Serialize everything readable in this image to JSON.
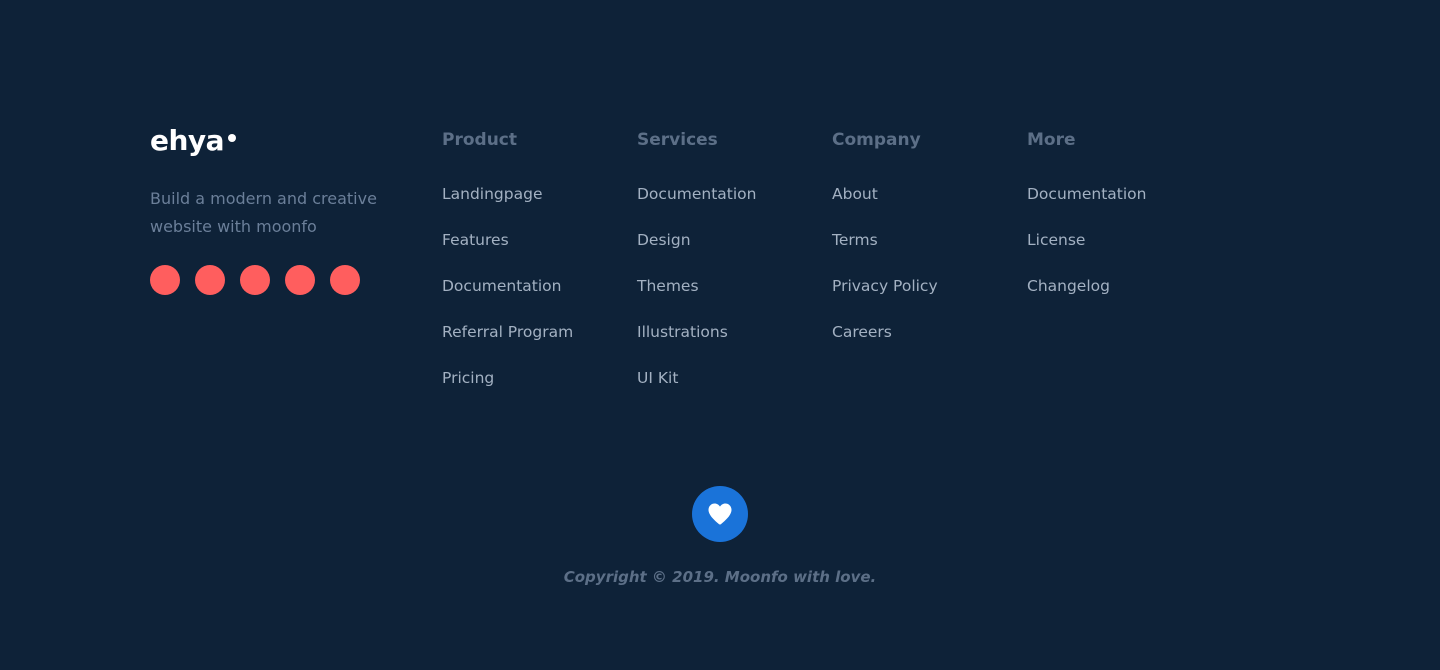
{
  "brand": {
    "logo_text": "ehya",
    "tagline": "Build a modern and creative website with moonfo",
    "social_links": [
      {
        "icon": "social-icon",
        "color": "#ff5e5e"
      },
      {
        "icon": "social-icon",
        "color": "#ff5e5e"
      },
      {
        "icon": "social-icon",
        "color": "#ff5e5e"
      },
      {
        "icon": "social-icon",
        "color": "#ff5e5e"
      },
      {
        "icon": "social-icon",
        "color": "#ff5e5e"
      }
    ]
  },
  "columns": [
    {
      "title": "Product",
      "links": [
        "Landingpage",
        "Features",
        "Documentation",
        "Referral Program",
        "Pricing"
      ]
    },
    {
      "title": "Services",
      "links": [
        "Documentation",
        "Design",
        "Themes",
        "Illustrations",
        "UI Kit"
      ]
    },
    {
      "title": "Company",
      "links": [
        "About",
        "Terms",
        "Privacy Policy",
        "Careers"
      ]
    },
    {
      "title": "More",
      "links": [
        "Documentation",
        "License",
        "Changelog"
      ]
    }
  ],
  "love_button": {
    "icon": "heart-icon",
    "color": "#1a73d9"
  },
  "copyright": "Copyright © 2019. Moonfo with love.",
  "colors": {
    "background": "#0e2238",
    "accent_social": "#ff5e5e",
    "accent_heart": "#1a73d9"
  }
}
